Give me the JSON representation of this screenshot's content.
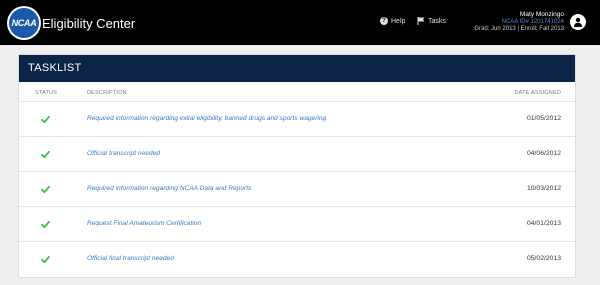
{
  "header": {
    "logo_text": "NCAA",
    "app_title": "Eligibility Center",
    "nav": {
      "help_label": "Help",
      "tasks_label": "Tasks"
    },
    "user": {
      "name": "Maty Monzingo",
      "ncaa_id": "NCAA ID# 1201741024",
      "dates": "Grad: Jun 2013 | Enroll: Fall 2013"
    }
  },
  "tasklist": {
    "title": "TASKLIST",
    "columns": {
      "status": "STATUS",
      "description": "DESCRIPTION",
      "date_assigned": "DATE ASSIGNED"
    },
    "rows": [
      {
        "status": "complete",
        "description": "Required information regarding initial eligibility, banned drugs and sports wagering",
        "date": "01/05/2012"
      },
      {
        "status": "complete",
        "description": "Official transcript needed",
        "date": "04/06/2012"
      },
      {
        "status": "complete",
        "description": "Required information regarding NCAA Data and Reports",
        "date": "10/03/2012"
      },
      {
        "status": "complete",
        "description": "Request Final Amateurism Certification",
        "date": "04/01/2013"
      },
      {
        "status": "complete",
        "description": "Official final transcript needed",
        "date": "05/02/2013"
      }
    ]
  },
  "colors": {
    "topbar": "#000000",
    "panel_header": "#0c2447",
    "link": "#3a7bbf",
    "check": "#3bc23b"
  },
  "icons": {
    "help": "help-circle-icon",
    "tasks": "flag-icon",
    "avatar": "user-icon",
    "status": "checkmark-icon"
  }
}
